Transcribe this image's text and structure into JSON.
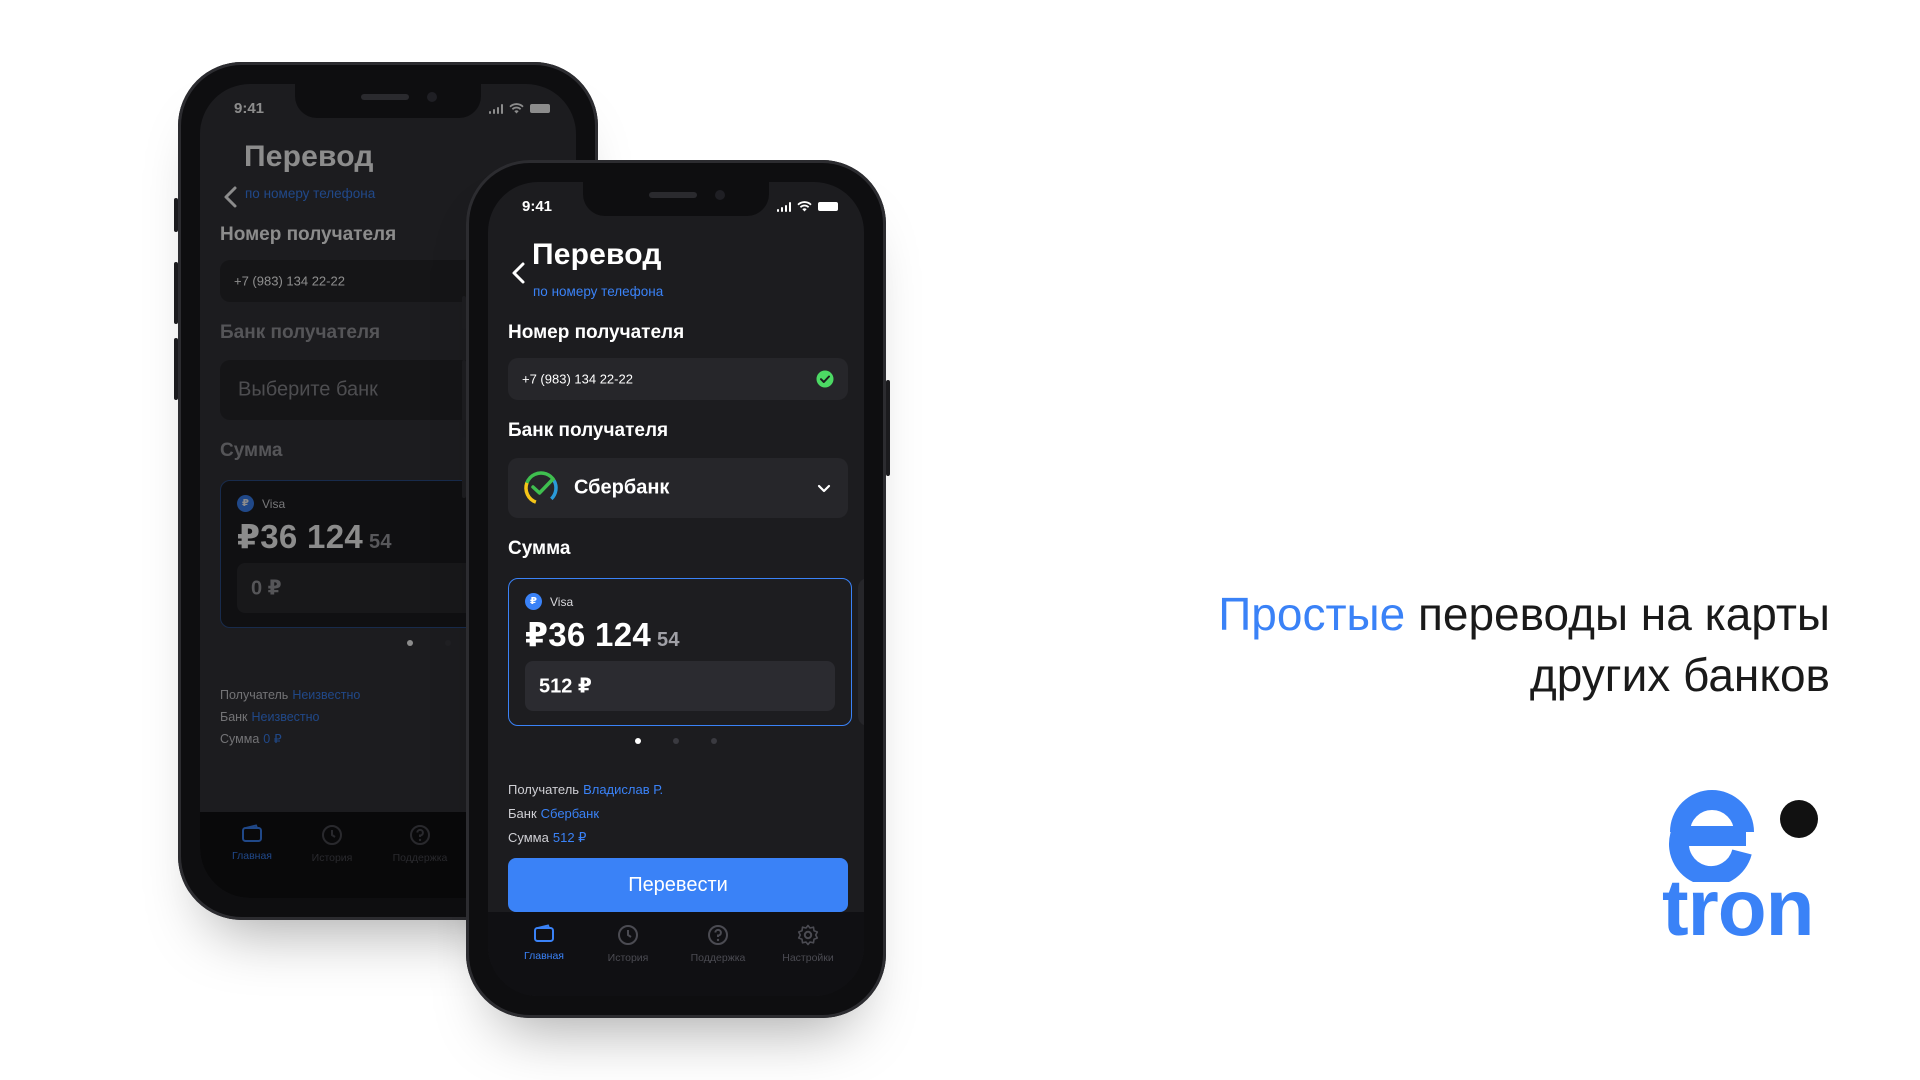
{
  "promo": {
    "headline_accent": "Простые",
    "headline_rest_line1": "переводы на карты",
    "headline_line2": "других банков",
    "brand_wordmark": "tron",
    "brand_letter": "e"
  },
  "colors": {
    "accent": "#3a82f7",
    "screen_bg": "#1c1c1f",
    "success": "#4cd964"
  },
  "phone_back": {
    "status_time": "9:41",
    "title": "Перевод",
    "subtitle": "по номеру телефона",
    "recipient_label": "Номер получателя",
    "recipient_value": "+7 (983) 134 22-22",
    "bank_label": "Банк получателя",
    "bank_placeholder": "Выберите банк",
    "sum_label": "Сумма",
    "card_currency_icon": "₽",
    "card_type": "Visa",
    "balance_main": "₽36 124",
    "balance_kop": "54",
    "amount": "0 ₽",
    "info": [
      {
        "key": "Получатель",
        "value": "Неизвестно"
      },
      {
        "key": "Банк",
        "value": "Неизвестно"
      },
      {
        "key": "Сумма",
        "value": "0 ₽"
      }
    ],
    "tabs": [
      "Главная",
      "История",
      "Поддержка"
    ]
  },
  "phone_front": {
    "status_time": "9:41",
    "title": "Перевод",
    "subtitle": "по номеру телефона",
    "recipient_label": "Номер получателя",
    "recipient_value": "+7 (983) 134 22-22",
    "bank_label": "Банк получателя",
    "bank_selected": "Сбербанк",
    "sum_label": "Сумма",
    "card_currency_icon": "₽",
    "card_type": "Visa",
    "balance_main": "₽36 124",
    "balance_kop": "54",
    "amount": "512 ₽",
    "info": [
      {
        "key": "Получатель",
        "value": "Владислав Р."
      },
      {
        "key": "Банк",
        "value": "Сбербанк"
      },
      {
        "key": "Сумма",
        "value": "512 ₽"
      }
    ],
    "cta_label": "Перевести",
    "tabs": [
      "Главная",
      "История",
      "Поддержка",
      "Настройки"
    ],
    "active_tab": "Главная",
    "carousel_active_index": 0
  }
}
